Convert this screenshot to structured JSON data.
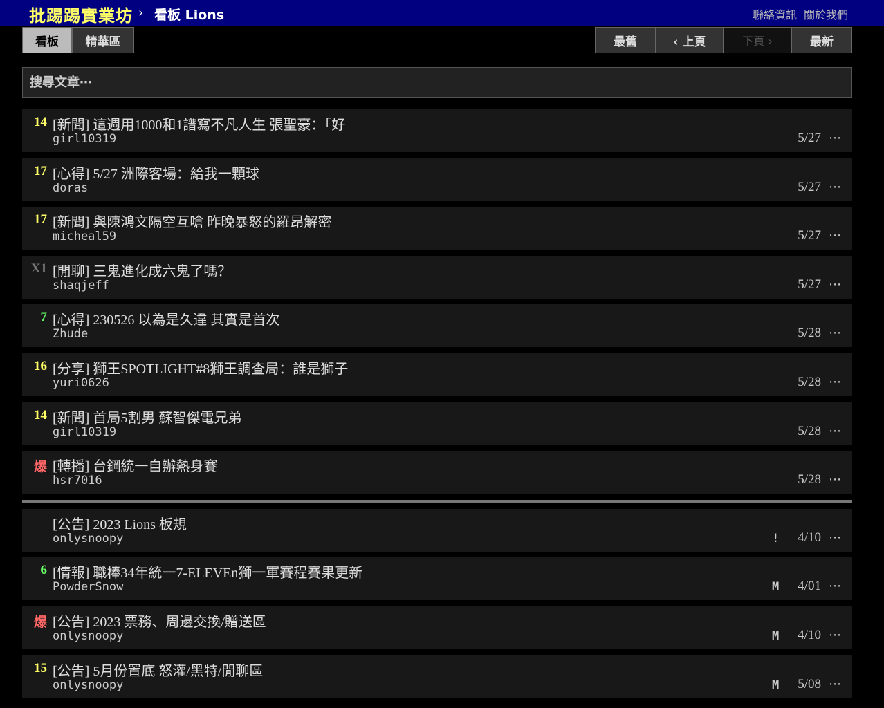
{
  "site": {
    "logo": "批踢踢實業坊",
    "crumb_sep": "›",
    "board": "看板 Lions",
    "links": [
      "聯絡資訊",
      "關於我們"
    ]
  },
  "tabs": {
    "board": "看板",
    "digest": "精華區"
  },
  "nav": {
    "oldest": "最舊",
    "prev": "‹ 上頁",
    "next": "下頁 ›",
    "newest": "最新"
  },
  "search": {
    "placeholder": "搜尋文章⋯"
  },
  "colors": {
    "yellow": "#ffff66",
    "green": "#66ff66",
    "red": "#ff6666",
    "gray": "#777777"
  },
  "posts": [
    {
      "nrec": "14",
      "nrec_color": "#ffff66",
      "title": "[新聞] 這週用1000和1譜寫不凡人生 張聖豪：「好",
      "author": "girl10319",
      "mark": "",
      "date": "5/27"
    },
    {
      "nrec": "17",
      "nrec_color": "#ffff66",
      "title": "[心得] 5/27 洲際客場：給我一顆球",
      "author": "doras",
      "mark": "",
      "date": "5/27"
    },
    {
      "nrec": "17",
      "nrec_color": "#ffff66",
      "title": "[新聞] 與陳鴻文隔空互嗆 昨晚暴怒的羅昂解密",
      "author": "micheal59",
      "mark": "",
      "date": "5/27"
    },
    {
      "nrec": "X1",
      "nrec_color": "#777777",
      "title": "[閒聊] 三鬼進化成六鬼了嗎？",
      "author": "shaqjeff",
      "mark": "",
      "date": "5/27"
    },
    {
      "nrec": "7",
      "nrec_color": "#66ff66",
      "title": "[心得] 230526 以為是久違 其實是首次",
      "author": "Zhude",
      "mark": "",
      "date": "5/28"
    },
    {
      "nrec": "16",
      "nrec_color": "#ffff66",
      "title": "[分享] 獅王SPOTLIGHT#8獅王調查局：誰是獅子",
      "author": "yuri0626",
      "mark": "",
      "date": "5/28"
    },
    {
      "nrec": "14",
      "nrec_color": "#ffff66",
      "title": "[新聞] 首局5割男 蘇智傑電兄弟",
      "author": "girl10319",
      "mark": "",
      "date": "5/28"
    },
    {
      "nrec": "爆",
      "nrec_color": "#ff6666",
      "title": "[轉播] 台鋼統一自辦熱身賽",
      "author": "hsr7016",
      "mark": "",
      "date": "5/28"
    }
  ],
  "pinned": [
    {
      "nrec": "",
      "nrec_color": "#ffff66",
      "title": "[公告] 2023 Lions 板規",
      "author": "onlysnoopy",
      "mark": "!",
      "date": "4/10"
    },
    {
      "nrec": "6",
      "nrec_color": "#66ff66",
      "title": "[情報] 職棒34年統一7-ELEVEn獅一軍賽程賽果更新",
      "author": "PowderSnow",
      "mark": "M",
      "date": "4/01"
    },
    {
      "nrec": "爆",
      "nrec_color": "#ff6666",
      "title": "[公告] 2023 票務、周邊交換/贈送區",
      "author": "onlysnoopy",
      "mark": "M",
      "date": "4/10"
    },
    {
      "nrec": "15",
      "nrec_color": "#ffff66",
      "title": "[公告] 5月份置底 怒灌/黑特/閒聊區",
      "author": "onlysnoopy",
      "mark": "M",
      "date": "5/08"
    }
  ],
  "more_icon": "⋯"
}
